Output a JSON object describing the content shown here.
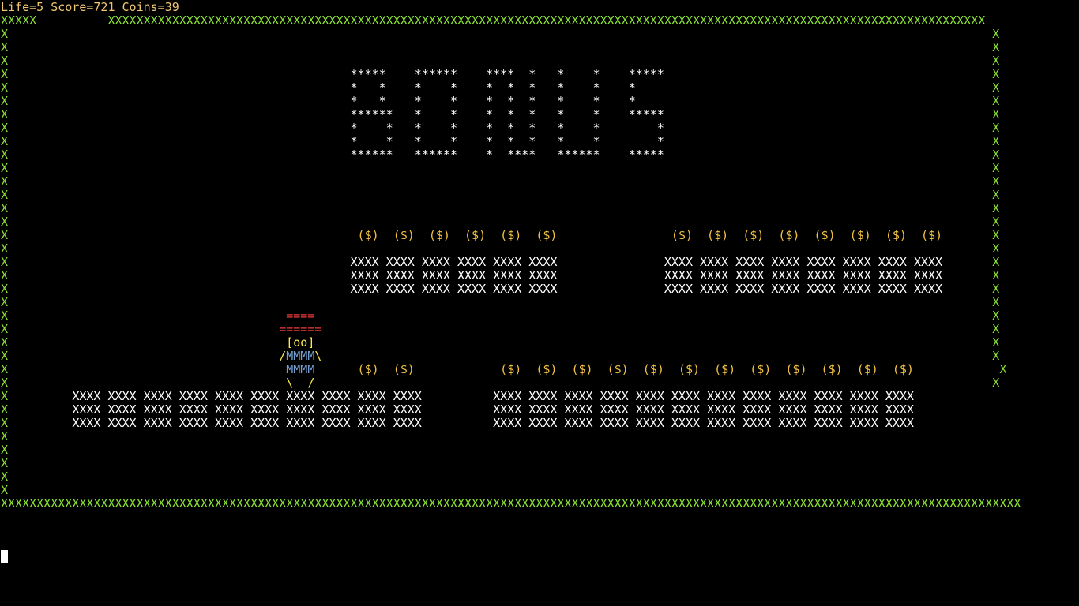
{
  "hud": {
    "text": "Life=5 Score=721 Coins=39",
    "life": 5,
    "score": 721,
    "coins": 39
  },
  "colors": {
    "wall": "#8ae234",
    "hud": "#f0c674",
    "coin": "#f0c040",
    "hat": "#ef3b3b",
    "player_body": "#729fcf",
    "text": "#ffffff"
  },
  "screen": {
    "rows": [
      "XXXXX          XXXXXXXXXXXXXXXXXXXXXXXXXXXXXXXXXXXXXXXXXXXXXXXXXXXXXXXXXXXXXXXXXXXXXXXXXXXXXXXXXXXXXXXXXXXXXXXXXXXXXXXXXXXXXXXXXXXXXXXXXXX",
      "X                                                                                                                                          X",
      "X                                                                                                                                          X",
      "X                                                                                                                                          X",
      "X                                                *****    ******    ****  *   *    *    *****                                              X",
      "X                                                *   *    *    *    *  *  *   *    *    *                                                  X",
      "X                                                *   *    *    *    *  *  *   *    *    *                                                  X",
      "X                                                ******   *    *    *  *  *   *    *    *****                                              X",
      "X                                                *    *   *    *    *  *  *   *    *        *                                              X",
      "X                                                *    *   *    *    *  *  *   *    *        *                                              X",
      "X                                                ******   ******    *  ****   ******    *****                                              X",
      "X                                                                                                                                          X",
      "X                                                                                                                                          X",
      "X                                                                                                                                          X",
      "X                                                                                                                                          X",
      "X                                                                                                                                          X",
      "X                                                 ($)  ($)  ($)  ($)  ($)  ($)                ($)  ($)  ($)  ($)  ($)  ($)  ($)  ($)       X",
      "X                                                                                                                                          X",
      "X                                                XXXX XXXX XXXX XXXX XXXX XXXX               XXXX XXXX XXXX XXXX XXXX XXXX XXXX XXXX       X",
      "X                                                XXXX XXXX XXXX XXXX XXXX XXXX               XXXX XXXX XXXX XXXX XXXX XXXX XXXX XXXX       X",
      "X                                                XXXX XXXX XXXX XXXX XXXX XXXX               XXXX XXXX XXXX XXXX XXXX XXXX XXXX XXXX       X",
      "X                                                                                                                                          X",
      "X                                       ====                                                                                               X",
      "X                                      ======                                                                                              X",
      "X                                       [oo]                                                                                               X",
      "X                                      /MMMM\\                                                                                              X",
      "X                                       MMMM      ($)  ($)            ($)  ($)  ($)  ($)  ($)  ($)  ($)  ($)  ($)  ($)  ($)  ($)            X",
      "X                                       \\  /                                                                                               X",
      "X         XXXX XXXX XXXX XXXX XXXX XXXX XXXX XXXX XXXX XXXX          XXXX XXXX XXXX XXXX XXXX XXXX XXXX XXXX XXXX XXXX XXXX XXXX",
      "X         XXXX XXXX XXXX XXXX XXXX XXXX XXXX XXXX XXXX XXXX          XXXX XXXX XXXX XXXX XXXX XXXX XXXX XXXX XXXX XXXX XXXX XXXX",
      "X         XXXX XXXX XXXX XXXX XXXX XXXX XXXX XXXX XXXX XXXX          XXXX XXXX XXXX XXXX XXXX XXXX XXXX XXXX XXXX XXXX XXXX XXXX",
      "X",
      "X",
      "X",
      "X",
      "X",
      "XXXXXXXXXXXXXXXXXXXXXXXXXXXXXXXXXXXXXXXXXXXXXXXXXXXXXXXXXXXXXXXXXXXXXXXXXXXXXXXXXXXXXXXXXXXXXXXXXXXXXXXXXXXXXXXXXXXXXXXXXXXXXXXXXXXXXXXXXXXXXXX"
    ]
  }
}
